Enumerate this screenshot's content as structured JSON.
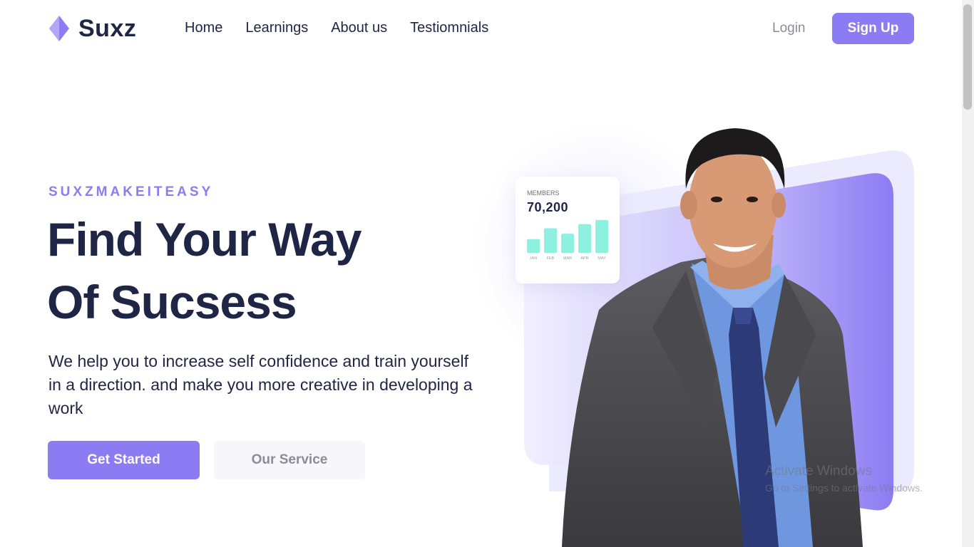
{
  "brand": {
    "name": "Suxz",
    "accent_color": "#8c7cf3",
    "logo_icon": "diamond-icon"
  },
  "nav": {
    "items": [
      {
        "label": "Home"
      },
      {
        "label": "Learnings"
      },
      {
        "label": "About us"
      },
      {
        "label": "Testiomnials"
      }
    ],
    "login_label": "Login",
    "signup_label": "Sign Up"
  },
  "hero": {
    "tagline": "SUXZMAKEITEASY",
    "headline_line1": "Find Your Way",
    "headline_line2": "Of Sucsess",
    "description": "We help you to increase self confidence and train yourself in a direction. and make you more creative in developing a work",
    "primary_button": "Get Started",
    "secondary_button": "Our Service"
  },
  "stats_card": {
    "label": "MEMBERS",
    "value": "70,200",
    "bar_color": "#8ef0de"
  },
  "chart_data": {
    "type": "bar",
    "categories": [
      "JAN",
      "FEB",
      "MAR",
      "APR",
      "MAY"
    ],
    "values": [
      20,
      36,
      28,
      42,
      48
    ],
    "ylim": [
      0,
      50
    ]
  },
  "watermark": {
    "title": "Activate Windows",
    "subtitle": "Go to Settings to activate Windows."
  }
}
